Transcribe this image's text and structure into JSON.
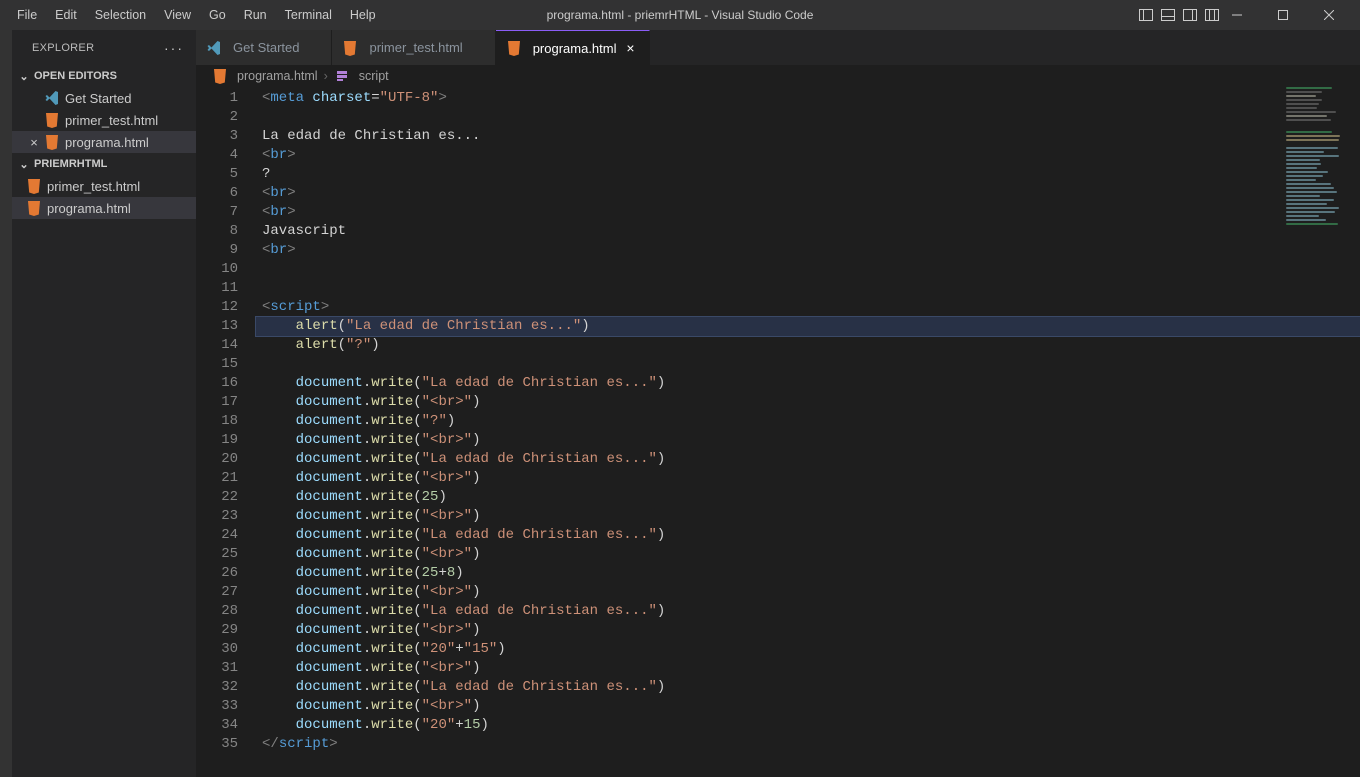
{
  "titlebar": {
    "menu": [
      "File",
      "Edit",
      "Selection",
      "View",
      "Go",
      "Run",
      "Terminal",
      "Help"
    ],
    "title": "programa.html - priemrHTML - Visual Studio Code"
  },
  "sidebar": {
    "title": "EXPLORER",
    "open_editors_label": "OPEN EDITORS",
    "open_editors": [
      {
        "label": "Get Started",
        "icon": "vscode",
        "active": false
      },
      {
        "label": "primer_test.html",
        "icon": "html",
        "active": false
      },
      {
        "label": "programa.html",
        "icon": "html",
        "active": true
      }
    ],
    "folder_label": "PRIEMRHTML",
    "folder_items": [
      {
        "label": "primer_test.html",
        "icon": "html",
        "active": false
      },
      {
        "label": "programa.html",
        "icon": "html",
        "active": true
      }
    ]
  },
  "tabs": [
    {
      "label": "Get Started",
      "icon": "vscode",
      "active": false
    },
    {
      "label": "primer_test.html",
      "icon": "html",
      "active": false
    },
    {
      "label": "programa.html",
      "icon": "html",
      "active": true
    }
  ],
  "breadcrumbs": {
    "file": "programa.html",
    "symbol": "script"
  },
  "code": {
    "lines": [
      {
        "n": 1,
        "t": [
          [
            "tag-bracket",
            "<"
          ],
          [
            "tag-name",
            "meta"
          ],
          [
            "plain",
            " "
          ],
          [
            "attr-name",
            "charset"
          ],
          [
            "attr-eq",
            "="
          ],
          [
            "attr-val",
            "\"UTF-8\""
          ],
          [
            "tag-bracket",
            ">"
          ]
        ]
      },
      {
        "n": 2,
        "t": []
      },
      {
        "n": 3,
        "t": [
          [
            "plain",
            "La edad de Christian es..."
          ]
        ]
      },
      {
        "n": 4,
        "t": [
          [
            "tag-bracket",
            "<"
          ],
          [
            "tag-name",
            "br"
          ],
          [
            "tag-bracket",
            ">"
          ]
        ]
      },
      {
        "n": 5,
        "t": [
          [
            "plain",
            "?"
          ]
        ]
      },
      {
        "n": 6,
        "t": [
          [
            "tag-bracket",
            "<"
          ],
          [
            "tag-name",
            "br"
          ],
          [
            "tag-bracket",
            ">"
          ]
        ]
      },
      {
        "n": 7,
        "t": [
          [
            "tag-bracket",
            "<"
          ],
          [
            "tag-name",
            "br"
          ],
          [
            "tag-bracket",
            ">"
          ]
        ]
      },
      {
        "n": 8,
        "t": [
          [
            "plain",
            "Javascript"
          ]
        ]
      },
      {
        "n": 9,
        "t": [
          [
            "tag-bracket",
            "<"
          ],
          [
            "tag-name",
            "br"
          ],
          [
            "tag-bracket",
            ">"
          ]
        ]
      },
      {
        "n": 10,
        "t": []
      },
      {
        "n": 11,
        "t": []
      },
      {
        "n": 12,
        "t": [
          [
            "tag-bracket",
            "<"
          ],
          [
            "tag-name",
            "script"
          ],
          [
            "tag-bracket",
            ">"
          ]
        ]
      },
      {
        "n": 13,
        "indent": 1,
        "hl": true,
        "cursor": true,
        "t": [
          [
            "fn",
            "alert"
          ],
          [
            "plain",
            "("
          ],
          [
            "str",
            "\"La edad de Christian es...\""
          ],
          [
            "plain",
            ")"
          ]
        ]
      },
      {
        "n": 14,
        "indent": 1,
        "t": [
          [
            "fn",
            "alert"
          ],
          [
            "plain",
            "("
          ],
          [
            "str",
            "\"?\""
          ],
          [
            "plain",
            ")"
          ]
        ]
      },
      {
        "n": 15,
        "t": []
      },
      {
        "n": 16,
        "indent": 1,
        "t": [
          [
            "obj",
            "document"
          ],
          [
            "plain",
            "."
          ],
          [
            "fn",
            "write"
          ],
          [
            "plain",
            "("
          ],
          [
            "str",
            "\"La edad de Christian es...\""
          ],
          [
            "plain",
            ")"
          ]
        ]
      },
      {
        "n": 17,
        "indent": 1,
        "t": [
          [
            "obj",
            "document"
          ],
          [
            "plain",
            "."
          ],
          [
            "fn",
            "write"
          ],
          [
            "plain",
            "("
          ],
          [
            "str",
            "\"<br>\""
          ],
          [
            "plain",
            ")"
          ]
        ]
      },
      {
        "n": 18,
        "indent": 1,
        "t": [
          [
            "obj",
            "document"
          ],
          [
            "plain",
            "."
          ],
          [
            "fn",
            "write"
          ],
          [
            "plain",
            "("
          ],
          [
            "str",
            "\"?\""
          ],
          [
            "plain",
            ")"
          ]
        ]
      },
      {
        "n": 19,
        "indent": 1,
        "t": [
          [
            "obj",
            "document"
          ],
          [
            "plain",
            "."
          ],
          [
            "fn",
            "write"
          ],
          [
            "plain",
            "("
          ],
          [
            "str",
            "\"<br>\""
          ],
          [
            "plain",
            ")"
          ]
        ]
      },
      {
        "n": 20,
        "indent": 1,
        "t": [
          [
            "obj",
            "document"
          ],
          [
            "plain",
            "."
          ],
          [
            "fn",
            "write"
          ],
          [
            "plain",
            "("
          ],
          [
            "str",
            "\"La edad de Christian es...\""
          ],
          [
            "plain",
            ")"
          ]
        ]
      },
      {
        "n": 21,
        "indent": 1,
        "t": [
          [
            "obj",
            "document"
          ],
          [
            "plain",
            "."
          ],
          [
            "fn",
            "write"
          ],
          [
            "plain",
            "("
          ],
          [
            "str",
            "\"<br>\""
          ],
          [
            "plain",
            ")"
          ]
        ]
      },
      {
        "n": 22,
        "indent": 1,
        "t": [
          [
            "obj",
            "document"
          ],
          [
            "plain",
            "."
          ],
          [
            "fn",
            "write"
          ],
          [
            "plain",
            "("
          ],
          [
            "num",
            "25"
          ],
          [
            "plain",
            ")"
          ]
        ]
      },
      {
        "n": 23,
        "indent": 1,
        "t": [
          [
            "obj",
            "document"
          ],
          [
            "plain",
            "."
          ],
          [
            "fn",
            "write"
          ],
          [
            "plain",
            "("
          ],
          [
            "str",
            "\"<br>\""
          ],
          [
            "plain",
            ")"
          ]
        ]
      },
      {
        "n": 24,
        "indent": 1,
        "t": [
          [
            "obj",
            "document"
          ],
          [
            "plain",
            "."
          ],
          [
            "fn",
            "write"
          ],
          [
            "plain",
            "("
          ],
          [
            "str",
            "\"La edad de Christian es...\""
          ],
          [
            "plain",
            ")"
          ]
        ]
      },
      {
        "n": 25,
        "indent": 1,
        "t": [
          [
            "obj",
            "document"
          ],
          [
            "plain",
            "."
          ],
          [
            "fn",
            "write"
          ],
          [
            "plain",
            "("
          ],
          [
            "str",
            "\"<br>\""
          ],
          [
            "plain",
            ")"
          ]
        ]
      },
      {
        "n": 26,
        "indent": 1,
        "t": [
          [
            "obj",
            "document"
          ],
          [
            "plain",
            "."
          ],
          [
            "fn",
            "write"
          ],
          [
            "plain",
            "("
          ],
          [
            "num",
            "25"
          ],
          [
            "op",
            "+"
          ],
          [
            "num",
            "8"
          ],
          [
            "plain",
            ")"
          ]
        ]
      },
      {
        "n": 27,
        "indent": 1,
        "t": [
          [
            "obj",
            "document"
          ],
          [
            "plain",
            "."
          ],
          [
            "fn",
            "write"
          ],
          [
            "plain",
            "("
          ],
          [
            "str",
            "\"<br>\""
          ],
          [
            "plain",
            ")"
          ]
        ]
      },
      {
        "n": 28,
        "indent": 1,
        "t": [
          [
            "obj",
            "document"
          ],
          [
            "plain",
            "."
          ],
          [
            "fn",
            "write"
          ],
          [
            "plain",
            "("
          ],
          [
            "str",
            "\"La edad de Christian es...\""
          ],
          [
            "plain",
            ")"
          ]
        ]
      },
      {
        "n": 29,
        "indent": 1,
        "t": [
          [
            "obj",
            "document"
          ],
          [
            "plain",
            "."
          ],
          [
            "fn",
            "write"
          ],
          [
            "plain",
            "("
          ],
          [
            "str",
            "\"<br>\""
          ],
          [
            "plain",
            ")"
          ]
        ]
      },
      {
        "n": 30,
        "indent": 1,
        "t": [
          [
            "obj",
            "document"
          ],
          [
            "plain",
            "."
          ],
          [
            "fn",
            "write"
          ],
          [
            "plain",
            "("
          ],
          [
            "str",
            "\"20\""
          ],
          [
            "op",
            "+"
          ],
          [
            "str",
            "\"15\""
          ],
          [
            "plain",
            ")"
          ]
        ]
      },
      {
        "n": 31,
        "indent": 1,
        "t": [
          [
            "obj",
            "document"
          ],
          [
            "plain",
            "."
          ],
          [
            "fn",
            "write"
          ],
          [
            "plain",
            "("
          ],
          [
            "str",
            "\"<br>\""
          ],
          [
            "plain",
            ")"
          ]
        ]
      },
      {
        "n": 32,
        "indent": 1,
        "t": [
          [
            "obj",
            "document"
          ],
          [
            "plain",
            "."
          ],
          [
            "fn",
            "write"
          ],
          [
            "plain",
            "("
          ],
          [
            "str",
            "\"La edad de Christian es...\""
          ],
          [
            "plain",
            ")"
          ]
        ]
      },
      {
        "n": 33,
        "indent": 1,
        "t": [
          [
            "obj",
            "document"
          ],
          [
            "plain",
            "."
          ],
          [
            "fn",
            "write"
          ],
          [
            "plain",
            "("
          ],
          [
            "str",
            "\"<br>\""
          ],
          [
            "plain",
            ")"
          ]
        ]
      },
      {
        "n": 34,
        "indent": 1,
        "t": [
          [
            "obj",
            "document"
          ],
          [
            "plain",
            "."
          ],
          [
            "fn",
            "write"
          ],
          [
            "plain",
            "("
          ],
          [
            "str",
            "\"20\""
          ],
          [
            "op",
            "+"
          ],
          [
            "num",
            "15"
          ],
          [
            "plain",
            ")"
          ]
        ]
      },
      {
        "n": 35,
        "t": [
          [
            "tag-bracket",
            "</"
          ],
          [
            "tag-name",
            "script"
          ],
          [
            "tag-bracket",
            ">"
          ]
        ]
      }
    ]
  }
}
